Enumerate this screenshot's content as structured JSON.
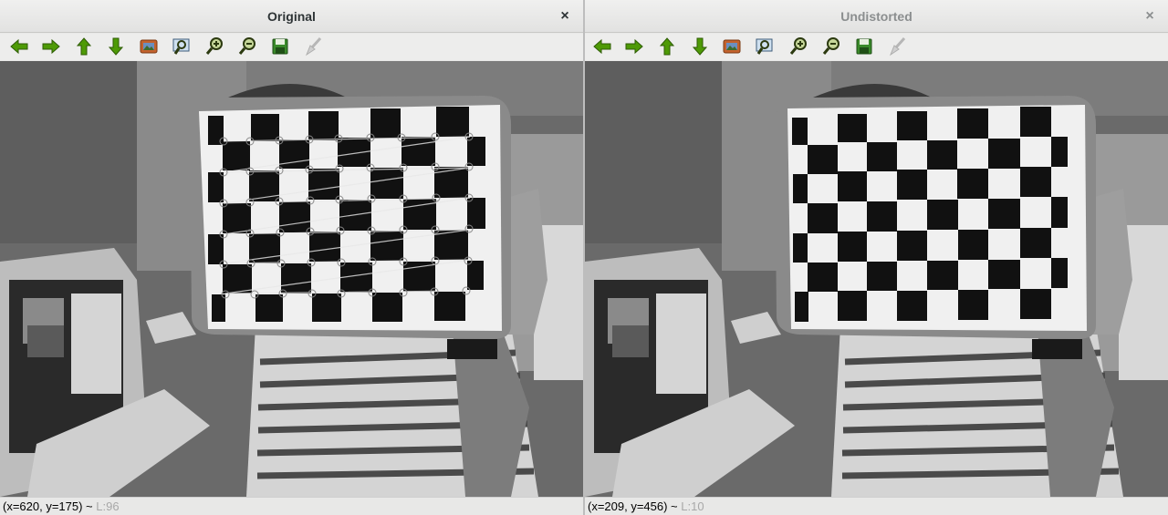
{
  "windows": [
    {
      "title": "Original",
      "close_label": "×",
      "status": {
        "coords": "(x=620, y=175) ~ ",
        "level": "L:96"
      }
    },
    {
      "title": "Undistorted",
      "close_label": "×",
      "status": {
        "coords": "(x=209, y=456) ~ ",
        "level": "L:10"
      }
    }
  ],
  "toolbar_icons": [
    "pan-left-icon",
    "pan-right-icon",
    "pan-up-icon",
    "pan-down-icon",
    "zoom-reset-icon",
    "zoom-region-icon",
    "zoom-in-icon",
    "zoom-out-icon",
    "save-icon",
    "properties-icon"
  ],
  "colors": {
    "arrow_green": "#4e9a06",
    "save_green": "#3a8a2a",
    "zoom_dark": "#2c3a10"
  }
}
